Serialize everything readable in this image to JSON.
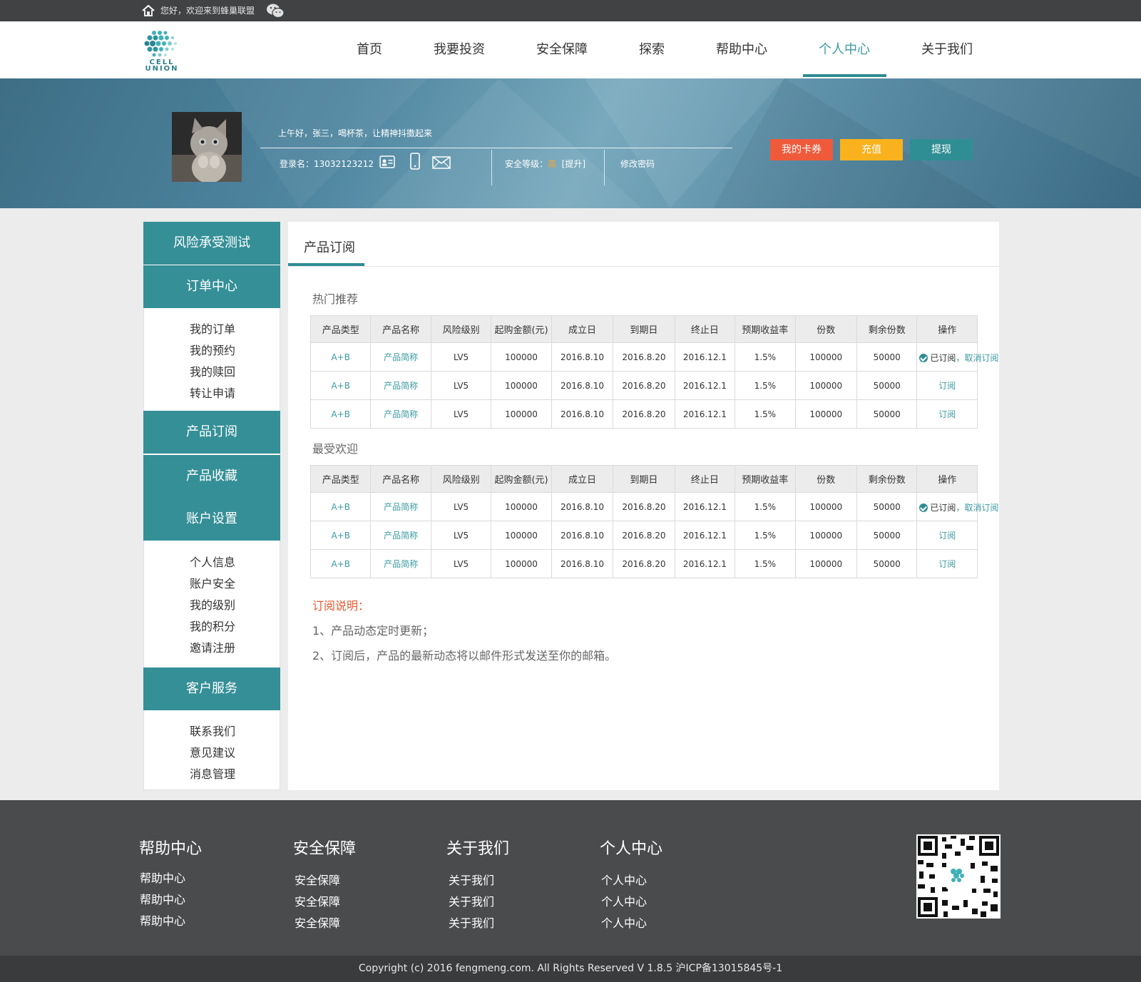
{
  "topbar": {
    "welcome": "您好，欢迎来到蜂巢联盟"
  },
  "logo": {
    "line1": "CELL",
    "line2": "UNION"
  },
  "nav": {
    "items": [
      "首页",
      "我要投资",
      "安全保障",
      "探索",
      "帮助中心",
      "个人中心",
      "关于我们"
    ],
    "active": "个人中心"
  },
  "profile": {
    "greeting": "上午好，张三，喝杯茶，让精神抖擞起来",
    "login_label": "登录名：",
    "login_name": "13032123212",
    "security_label": "安全等级：",
    "security_level": "高",
    "upgrade": "[提升]",
    "change_password": "修改密码",
    "buttons": {
      "coupons": "我的卡券",
      "recharge": "充值",
      "withdraw": "提现"
    }
  },
  "sidebar": {
    "risk_test": "风险承受测试",
    "order_center": "订单中心",
    "order_items": [
      "我的订单",
      "我的预约",
      "我的赎回",
      "转让申请"
    ],
    "product_subscribe": "产品订阅",
    "product_favorites": "产品收藏",
    "account_settings": "账户设置",
    "account_items": [
      "个人信息",
      "账户安全",
      "我的级别",
      "我的积分",
      "邀请注册"
    ],
    "customer_service": "客户服务",
    "service_items": [
      "联系我们",
      "意见建议",
      "消息管理"
    ]
  },
  "main": {
    "tab": "产品订阅",
    "table_headers": [
      "产品类型",
      "产品名称",
      "风险级别",
      "起购金额(元)",
      "成立日",
      "到期日",
      "终止日",
      "预期收益率",
      "份数",
      "剩余份数",
      "操作"
    ],
    "hot": {
      "title": "热门推荐",
      "rows": [
        [
          "A+B",
          "产品简称",
          "LV5",
          "100000",
          "2016.8.10",
          "2016.8.20",
          "2016.12.1",
          "1.5%",
          "100000",
          "50000"
        ],
        [
          "A+B",
          "产品简称",
          "LV5",
          "100000",
          "2016.8.10",
          "2016.8.20",
          "2016.12.1",
          "1.5%",
          "100000",
          "50000"
        ],
        [
          "A+B",
          "产品简称",
          "LV5",
          "100000",
          "2016.8.10",
          "2016.8.20",
          "2016.12.1",
          "1.5%",
          "100000",
          "50000"
        ]
      ]
    },
    "popular": {
      "title": "最受欢迎",
      "rows": [
        [
          "A+B",
          "产品简称",
          "LV5",
          "100000",
          "2016.8.10",
          "2016.8.20",
          "2016.12.1",
          "1.5%",
          "100000",
          "50000"
        ],
        [
          "A+B",
          "产品简称",
          "LV5",
          "100000",
          "2016.8.10",
          "2016.8.20",
          "2016.12.1",
          "1.5%",
          "100000",
          "50000"
        ],
        [
          "A+B",
          "产品简称",
          "LV5",
          "100000",
          "2016.8.10",
          "2016.8.20",
          "2016.12.1",
          "1.5%",
          "100000",
          "50000"
        ]
      ]
    },
    "op_subscribed": "已订阅",
    "op_sep": "，",
    "op_cancel": "取消订阅",
    "op_subscribe": "订阅",
    "note_title": "订阅说明：",
    "note_lines": [
      "1、产品动态定时更新；",
      "2、订阅后，产品的最新动态将以邮件形式发送至你的邮箱。"
    ]
  },
  "footer": {
    "columns": [
      {
        "title": "帮助中心",
        "items": [
          "帮助中心",
          "帮助中心",
          "帮助中心"
        ]
      },
      {
        "title": "安全保障",
        "items": [
          "安全保障",
          "安全保障",
          "安全保障"
        ]
      },
      {
        "title": "关于我们",
        "items": [
          "关于我们",
          "关于我们",
          "关于我们"
        ]
      },
      {
        "title": "个人中心",
        "items": [
          "个人中心",
          "个人中心",
          "个人中心"
        ]
      }
    ],
    "copyright": "Copyright (c) 2016 fengmeng.com. All Rights Reserved V 1.8.5 沪ICP备13015845号-1"
  },
  "colors": {
    "accent": "#358f97",
    "danger": "#ef5a3a",
    "warning": "#f9b21d",
    "dark": "#414244"
  }
}
